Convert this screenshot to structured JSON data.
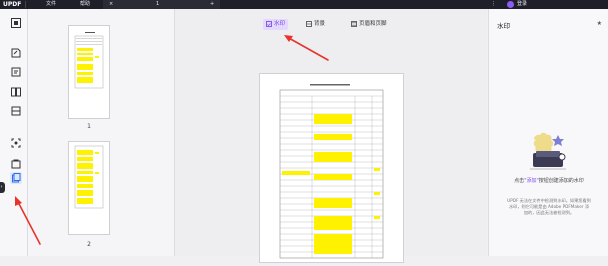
{
  "titlebar": {
    "logo": "UPDF",
    "tab_file": "文件",
    "tab_help": "帮助",
    "close_tab": "×",
    "doc_tab": "1",
    "add_tab": "+",
    "menu_icon": "⋮",
    "login": "登录"
  },
  "thumbnails": [
    {
      "page": "1"
    },
    {
      "page": "2"
    }
  ],
  "canvas": {
    "tabs": [
      {
        "label": "水印",
        "active": true
      },
      {
        "label": "背景",
        "active": false
      },
      {
        "label": "页眉和页脚",
        "active": false
      }
    ]
  },
  "right_panel": {
    "title": "水印",
    "pin": "★",
    "desc_prefix": "点击",
    "desc_highlight": "\"添加\"",
    "desc_suffix": "按钮创建添加的水印",
    "note": "UPDF 无法在文件中检测到水印。如果您看到水印，则它可能是由 Adobe PDFMaker 添加的，因此无法被检测到。"
  },
  "colors": {
    "accent": "#7a4ee8",
    "titlebar": "#1f1f29",
    "arrow": "#e8342a",
    "highlight": "#fff200"
  }
}
